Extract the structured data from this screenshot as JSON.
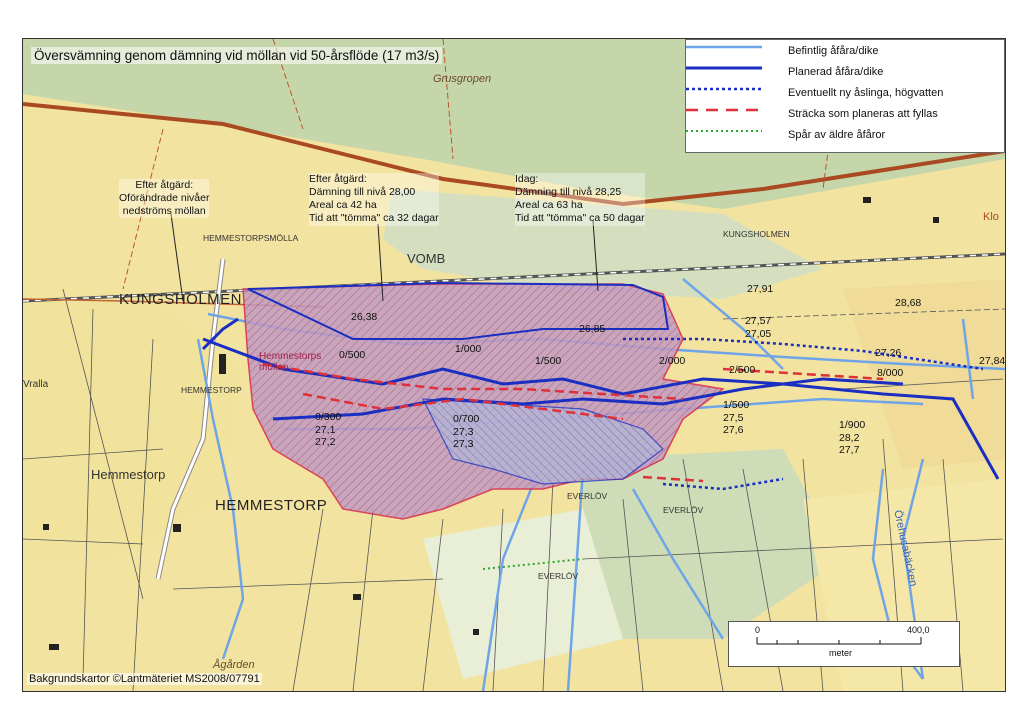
{
  "title": "Översvämning genom dämning vid möllan vid 50-årsflöde (17 m3/s)",
  "legend": [
    {
      "label": "Befintlig åfåra/dike",
      "color": "#6fa4e8",
      "style": "solid-thin"
    },
    {
      "label": "Planerad åfåra/dike",
      "color": "#1a2fc2",
      "style": "solid-thick"
    },
    {
      "label": "Eventuellt ny åslinga, högvatten",
      "color": "#1a2fc2",
      "style": "dotted"
    },
    {
      "label": "Sträcka som planeras att fyllas",
      "color": "#e0303a",
      "style": "dashed"
    },
    {
      "label": "Spår av äldre åfåror",
      "color": "#2aa82a",
      "style": "dotted"
    }
  ],
  "annotations": {
    "a1": [
      "Efter åtgärd:",
      "Oförändrade nivåer",
      "nedströms möllan"
    ],
    "a2": [
      "Efter åtgärd:",
      "Dämning till nivå 28,00",
      "Areal ca 42 ha",
      "Tid att \"tömma\" ca 32 dagar"
    ],
    "a3": [
      "Idag:",
      "Dämning till nivå 28,25",
      "Areal ca 63 ha",
      "Tid att \"tömma\" ca 50 dagar"
    ]
  },
  "places": {
    "kungsholmen": "KUNGSHOLMEN",
    "hemmestorp_big": "HEMMESTORP",
    "vomb": "VOMB",
    "hemmestorp": "Hemmestorp",
    "grusgropen": "Grusgropen",
    "hemmestorpsmolla": "HEMMESTORPSMÖLLA",
    "hemmestorp_small": "HEMMESTORP",
    "kungsholmen_small": "KUNGSHOLMEN",
    "everlov1": "EVERLÖV",
    "everlov2": "EVERLÖV",
    "everlov3": "EVERLÖV",
    "agarden": "Ågården",
    "orehusabacken": "Örehusabäcken",
    "hemmestorp_mill": "Hemmestorps möllan",
    "vralla": "Vralla",
    "klo": "Klo"
  },
  "labels": {
    "l1": "26,38",
    "l2": "0/500",
    "l3": "1/000",
    "l4": "1/500",
    "l5": "26,85",
    "l6": "2/000",
    "l7": "2/500",
    "l8": [
      "27,57",
      "27,05"
    ],
    "l9": "27,26",
    "l10": "8/000",
    "l11": "27,84",
    "l12": "27,91",
    "l13": "28,68",
    "l14": [
      "0/300",
      "27,1",
      "27,2"
    ],
    "l15": [
      "0/700",
      "27,3",
      "27,3"
    ],
    "l16": [
      "1/500",
      "27,5",
      "27,6"
    ],
    "l17": [
      "1/900",
      "28,2",
      "27,7"
    ]
  },
  "scalebar": {
    "start": "0",
    "end": "400,0",
    "unit": "meter"
  },
  "credit": "Bakgrundskartor ©Lantmäteriet MS2008/07791",
  "colors": {
    "forest": "#c8d9b0",
    "field": "#f3e6a8",
    "flood_fill": "#b986b0",
    "flood_outline_blue": "#1a2fc2",
    "flood_outline_red": "#d7264b",
    "road": "#b8572e",
    "stream": "#6fa4e8"
  }
}
